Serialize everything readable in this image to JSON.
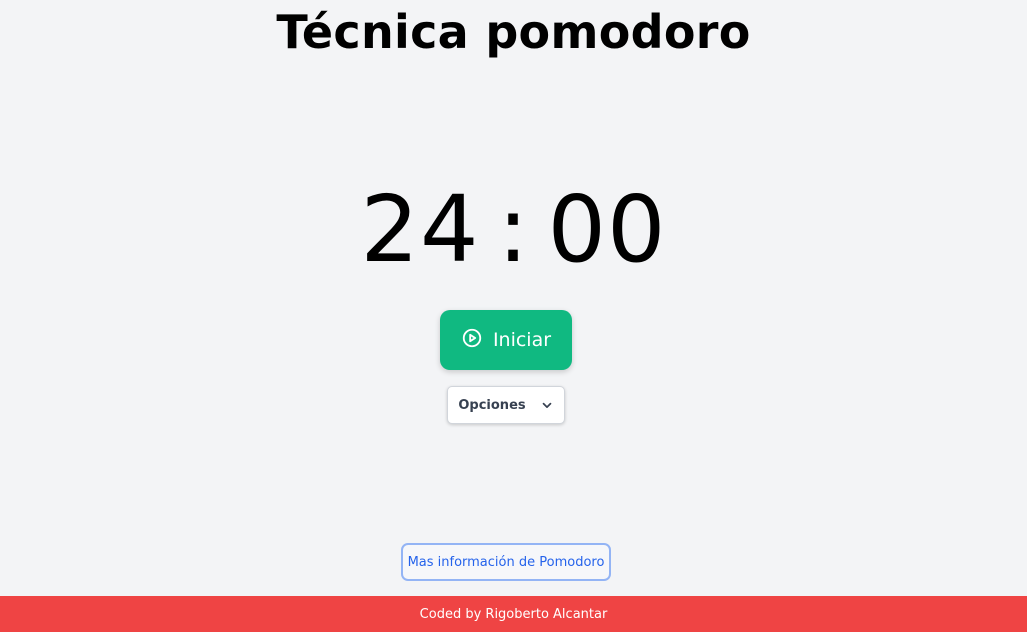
{
  "header": {
    "title": "Técnica pomodoro"
  },
  "timer": {
    "minutes": "24",
    "separator": ":",
    "seconds": "00"
  },
  "controls": {
    "start_label": "Iniciar",
    "start_icon": "play-circle-icon",
    "options_label": "Opciones",
    "options_icon": "chevron-down-icon"
  },
  "info": {
    "link_label": "Mas información de Pomodoro"
  },
  "footer": {
    "credit": "Coded by Rigoberto Alcantar"
  },
  "colors": {
    "background": "#f3f4f6",
    "start_button": "#10b981",
    "footer": "#ef4444",
    "link": "#2563eb"
  }
}
